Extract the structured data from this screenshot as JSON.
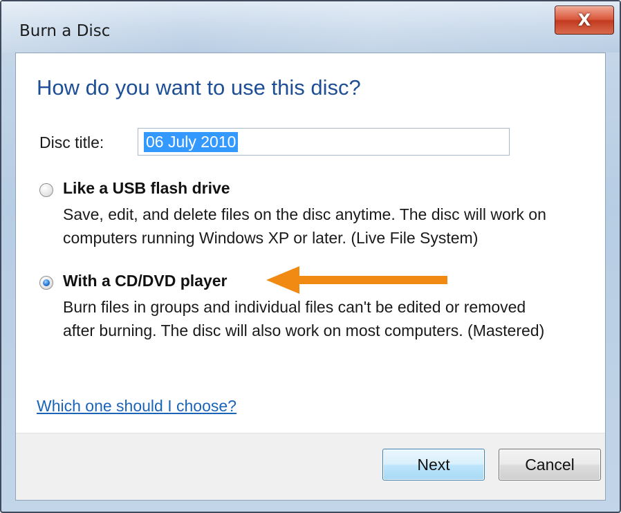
{
  "window": {
    "title": "Burn a Disc",
    "close_glyph": "X"
  },
  "main": {
    "heading": "How do you want to use this disc?",
    "disc_title_label": "Disc title:",
    "disc_title_value": "06 July 2010",
    "options": [
      {
        "title": "Like a USB flash drive",
        "description": "Save, edit, and delete files on the disc anytime. The disc will work on computers running Windows XP or later. (Live File System)",
        "selected": false
      },
      {
        "title": "With a CD/DVD player",
        "description": "Burn files in groups and individual files can't be edited or removed after burning. The disc will also work on most computers. (Mastered)",
        "selected": true
      }
    ],
    "help_link": "Which one should I choose?"
  },
  "footer": {
    "next_label": "Next",
    "cancel_label": "Cancel"
  },
  "annotation": {
    "arrow_color": "#f08a12",
    "arrow_icon": "arrow-left-icon"
  },
  "colors": {
    "heading": "#1e4f96",
    "link": "#1a64b8",
    "selection": "#3399ff"
  }
}
